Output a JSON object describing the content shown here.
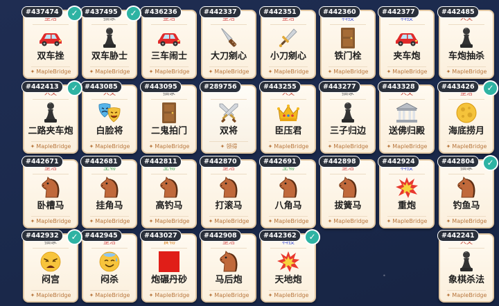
{
  "colors": {
    "cat_整活": "#d24a4a",
    "cat_抽象": "#6d6d6d",
    "cat_人文": "#c0392b",
    "cat_科技": "#3c4ed6",
    "cat_生物": "#2e9a48",
    "cat_食物": "#d47b15",
    "id_tag": "#2a303b",
    "check": "#2eb3a3",
    "author": "#b8763c"
  },
  "cards": [
    {
      "id": "#437474",
      "category": "整活",
      "title": "双车挫",
      "author": "MapleBridge",
      "icon": "car-icon",
      "checked": true
    },
    {
      "id": "#437495",
      "category": "抽象",
      "title": "双车胁士",
      "author": "MapleBridge",
      "icon": "chess-pawn-icon",
      "checked": true
    },
    {
      "id": "#436236",
      "category": "整活",
      "title": "三车闹士",
      "author": "MapleBridge",
      "icon": "car-icon",
      "checked": false
    },
    {
      "id": "#442337",
      "category": "整活",
      "title": "大刀剜心",
      "author": "MapleBridge",
      "icon": "knife-icon",
      "checked": false
    },
    {
      "id": "#442351",
      "category": "整活",
      "title": "小刀剜心",
      "author": "MapleBridge",
      "icon": "dagger-icon",
      "checked": false
    },
    {
      "id": "#442360",
      "category": "科技",
      "title": "铁门栓",
      "author": "MapleBridge",
      "icon": "door-icon",
      "checked": false
    },
    {
      "id": "#442377",
      "category": "科技",
      "title": "夹车炮",
      "author": "MapleBridge",
      "icon": "car-icon",
      "checked": false
    },
    {
      "id": "#442485",
      "category": "人文",
      "title": "车炮抽杀",
      "author": "MapleBridge",
      "icon": "chess-pawn-icon",
      "checked": false
    },
    {
      "id": "#442413",
      "category": "人文",
      "title": "二路夹车炮",
      "author": "MapleBridge",
      "icon": "chess-pawn-icon",
      "checked": true
    },
    {
      "id": "#443085",
      "category": "人文",
      "title": "白脸将",
      "author": "MapleBridge",
      "icon": "theater-masks-icon",
      "checked": false
    },
    {
      "id": "#443095",
      "category": "抽象",
      "title": "二鬼拍门",
      "author": "MapleBridge",
      "icon": "door-icon",
      "checked": false
    },
    {
      "id": "#289756",
      "category": "",
      "title": "双将",
      "author": "领得",
      "icon": "crossed-swords-icon",
      "checked": false
    },
    {
      "id": "#443255",
      "category": "人文",
      "title": "臣压君",
      "author": "MapleBridge",
      "icon": "crown-icon",
      "checked": false
    },
    {
      "id": "#443277",
      "category": "抽象",
      "title": "三子归边",
      "author": "MapleBridge",
      "icon": "chess-pawn-icon",
      "checked": false
    },
    {
      "id": "#443328",
      "category": "人文",
      "title": "送佛归殿",
      "author": "MapleBridge",
      "icon": "classical-building-icon",
      "checked": false
    },
    {
      "id": "#443426",
      "category": "整活",
      "title": "海底捞月",
      "author": "MapleBridge",
      "icon": "full-moon-icon",
      "checked": true
    },
    {
      "id": "#442671",
      "category": "整活",
      "title": "卧槽马",
      "author": "MapleBridge",
      "icon": "horse-icon",
      "checked": false
    },
    {
      "id": "#442681",
      "category": "生物",
      "title": "挂角马",
      "author": "MapleBridge",
      "icon": "horse-icon",
      "checked": false
    },
    {
      "id": "#442811",
      "category": "生物",
      "title": "高钓马",
      "author": "MapleBridge",
      "icon": "horse-icon",
      "checked": false
    },
    {
      "id": "#442870",
      "category": "整活",
      "title": "打滚马",
      "author": "MapleBridge",
      "icon": "horse-icon",
      "checked": false
    },
    {
      "id": "#442691",
      "category": "生物",
      "title": "八角马",
      "author": "MapleBridge",
      "icon": "horse-icon",
      "checked": false
    },
    {
      "id": "#442898",
      "category": "整活",
      "title": "拔簧马",
      "author": "MapleBridge",
      "icon": "horse-icon",
      "checked": false
    },
    {
      "id": "#442924",
      "category": "科技",
      "title": "重炮",
      "author": "MapleBridge",
      "icon": "explosion-icon",
      "checked": false
    },
    {
      "id": "#442804",
      "category": "抽象",
      "title": "钓鱼马",
      "author": "MapleBridge",
      "icon": "horse-icon",
      "checked": true
    },
    {
      "id": "#442932",
      "category": "抽象",
      "title": "闷宫",
      "author": "MapleBridge",
      "icon": "weary-face-icon",
      "checked": true
    },
    {
      "id": "#442945",
      "category": "整活",
      "title": "闷杀",
      "author": "MapleBridge",
      "icon": "sweat-face-icon",
      "checked": false
    },
    {
      "id": "#443027",
      "category": "食物",
      "title": "炮碾丹砂",
      "author": "MapleBridge",
      "icon": "red-square-icon",
      "checked": false
    },
    {
      "id": "#442908",
      "category": "整活",
      "title": "马后炮",
      "author": "MapleBridge",
      "icon": "horse-icon",
      "checked": false
    },
    {
      "id": "#442362",
      "category": "科技",
      "title": "天地炮",
      "author": "MapleBridge",
      "icon": "explosion-icon",
      "checked": true
    },
    null,
    null,
    {
      "id": "#442241",
      "category": "人文",
      "title": "象棋杀法",
      "author": "MapleBridge",
      "icon": "chess-pawn-icon",
      "checked": false
    }
  ]
}
